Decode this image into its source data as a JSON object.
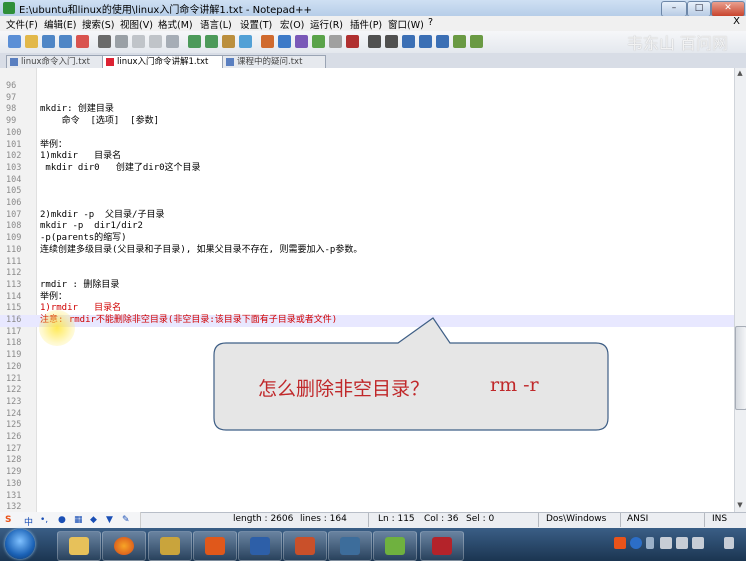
{
  "window": {
    "title": "E:\\ubuntu和linux的使用\\linux入门命令讲解1.txt - Notepad++",
    "min_label": "–",
    "max_label": "□",
    "close_label": "✕"
  },
  "menu": [
    "文件(F)",
    "编辑(E)",
    "搜索(S)",
    "视图(V)",
    "格式(M)",
    "语言(L)",
    "设置(T)",
    "宏(O)",
    "运行(R)",
    "插件(P)",
    "窗口(W)",
    "?"
  ],
  "menu_close": "X",
  "watermark": "韦东山 百问网",
  "tabs": [
    {
      "label": "linux命令入门.txt",
      "active": false
    },
    {
      "label": "linux入门命令讲解1.txt",
      "active": true
    },
    {
      "label": "课程中的疑问.txt",
      "active": false
    }
  ],
  "editor": {
    "lines": [
      {
        "n": "96",
        "t": ""
      },
      {
        "n": "97",
        "t": ""
      },
      {
        "n": "98",
        "t": "mkdir: 创建目录"
      },
      {
        "n": "99",
        "t": "    命令  [选项]  [参数]"
      },
      {
        "n": "100",
        "t": ""
      },
      {
        "n": "101",
        "t": "举例："
      },
      {
        "n": "102",
        "t": "1)mkdir   目录名"
      },
      {
        "n": "103",
        "t": " mkdir dir0   创建了dir0这个目录"
      },
      {
        "n": "104",
        "t": ""
      },
      {
        "n": "105",
        "t": ""
      },
      {
        "n": "106",
        "t": ""
      },
      {
        "n": "107",
        "t": "2)mkdir -p  父目录/子目录"
      },
      {
        "n": "108",
        "t": "mkdir -p  dir1/dir2"
      },
      {
        "n": "109",
        "t": "-p(parents的缩写)"
      },
      {
        "n": "110",
        "t": "连续创建多级目录(父目录和子目录), 如果父目录不存在, 则需要加入-p参数。"
      },
      {
        "n": "111",
        "t": ""
      },
      {
        "n": "112",
        "t": ""
      },
      {
        "n": "113",
        "t": "rmdir : 删除目录"
      },
      {
        "n": "114",
        "t": "举例："
      },
      {
        "n": "115",
        "t": "1)rmdir   目录名"
      },
      {
        "n": "116",
        "t": "注意: rmdir不能删除非空目录(非空目录:该目录下面有子目录或者文件)"
      },
      {
        "n": "117",
        "t": ""
      },
      {
        "n": "118",
        "t": ""
      },
      {
        "n": "119",
        "t": ""
      },
      {
        "n": "120",
        "t": ""
      },
      {
        "n": "121",
        "t": ""
      },
      {
        "n": "122",
        "t": ""
      },
      {
        "n": "123",
        "t": ""
      },
      {
        "n": "124",
        "t": ""
      },
      {
        "n": "125",
        "t": ""
      },
      {
        "n": "126",
        "t": ""
      },
      {
        "n": "127",
        "t": ""
      },
      {
        "n": "128",
        "t": ""
      },
      {
        "n": "129",
        "t": ""
      },
      {
        "n": "130",
        "t": ""
      },
      {
        "n": "131",
        "t": ""
      },
      {
        "n": "132",
        "t": ""
      }
    ],
    "line_number_labels": [
      "96",
      "97",
      "98",
      "99",
      "100",
      "101",
      "102",
      "103",
      "104",
      "105",
      "106",
      "107",
      "108",
      "109",
      "110",
      "111",
      "112",
      "113",
      "114",
      "114",
      "115",
      "115",
      "116",
      "117",
      "118",
      "119",
      "120",
      "121",
      "122",
      "123",
      "124",
      "125",
      "126",
      "127",
      "128",
      "129",
      "130"
    ]
  },
  "callout": {
    "text": "怎么删除非空目录？",
    "command": "rm -r",
    "fill_color": "#e6e6e6",
    "border_color": "#3f5f86"
  },
  "status": {
    "length": "length : 2606",
    "lines": "lines : 164",
    "ln": "Ln : 115",
    "col": "Col : 36",
    "sel": "Sel : 0",
    "eol": "Dos\\Windows",
    "encoding": "ANSI",
    "mode": "INS"
  },
  "ime": {
    "logo": "S",
    "lang": "中",
    "punct": "•,",
    "mic": "🎤"
  },
  "colors": {
    "accent_red": "#c0282a",
    "current_line": "#e8e8ff"
  }
}
